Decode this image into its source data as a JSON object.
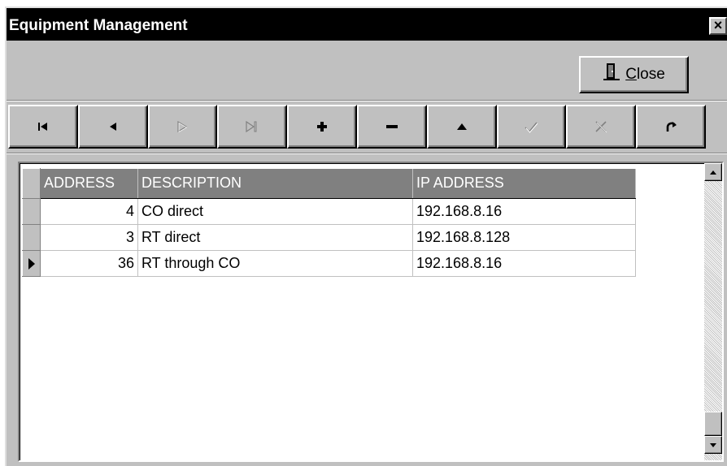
{
  "window": {
    "title": "Equipment Management",
    "close_glyph": "×"
  },
  "toolbar": {
    "close_label_hotkey": "C",
    "close_label_rest": "lose",
    "close_icon": "door-icon"
  },
  "navigator": [
    {
      "name": "first-record",
      "icon": "first-icon",
      "enabled": true
    },
    {
      "name": "prior-record",
      "icon": "prior-icon",
      "enabled": true
    },
    {
      "name": "next-record",
      "icon": "next-icon",
      "enabled": false
    },
    {
      "name": "last-record",
      "icon": "last-icon",
      "enabled": false
    },
    {
      "name": "insert-record",
      "icon": "plus-icon",
      "enabled": true
    },
    {
      "name": "delete-record",
      "icon": "minus-icon",
      "enabled": true
    },
    {
      "name": "edit-record",
      "icon": "up-triangle-icon",
      "enabled": true
    },
    {
      "name": "post-edit",
      "icon": "checkmark-icon",
      "enabled": false
    },
    {
      "name": "cancel-edit",
      "icon": "cross-icon",
      "enabled": false
    },
    {
      "name": "refresh-data",
      "icon": "refresh-icon",
      "enabled": true
    }
  ],
  "grid": {
    "columns": [
      "ADDRESS",
      "DESCRIPTION",
      "IP ADDRESS"
    ],
    "rows": [
      {
        "address": "4",
        "description": "CO direct",
        "ip": "192.168.8.16",
        "current": false
      },
      {
        "address": "3",
        "description": "RT direct",
        "ip": "192.168.8.128",
        "current": false
      },
      {
        "address": "36",
        "description": "RT through CO",
        "ip": "192.168.8.16",
        "current": true
      }
    ]
  },
  "colors": {
    "title_bar": "#000000",
    "face": "#c0c0c0",
    "header_bg": "#808080",
    "header_text": "#ffffff"
  }
}
